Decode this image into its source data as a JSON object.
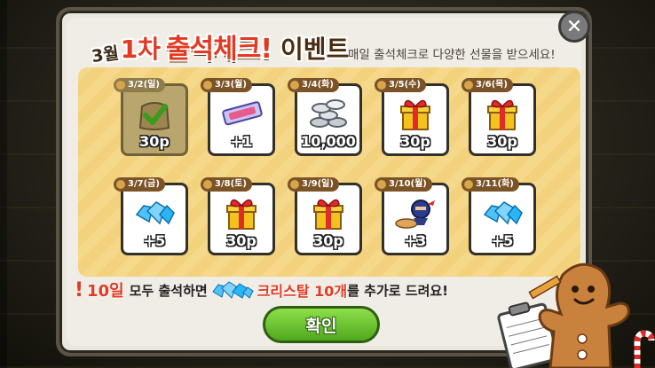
{
  "title": {
    "month": "3월",
    "round": "1차",
    "main": "출석체크!",
    "event": "이벤트",
    "subtitle": "매일 출석체크로 다양한 선물을 받으세요!"
  },
  "rewards": [
    {
      "date": "3/2(일)",
      "icon": "check-pouch-icon",
      "amount": "30p",
      "claimed": true
    },
    {
      "date": "3/3(월)",
      "icon": "ticket-icon",
      "amount": "+1",
      "claimed": false
    },
    {
      "date": "3/4(화)",
      "icon": "coins-icon",
      "amount": "10,000",
      "claimed": false
    },
    {
      "date": "3/5(수)",
      "icon": "gift-icon",
      "amount": "30p",
      "claimed": false
    },
    {
      "date": "3/6(목)",
      "icon": "gift-icon",
      "amount": "30p",
      "claimed": false
    },
    {
      "date": "3/7(금)",
      "icon": "crystal-icon",
      "amount": "+5",
      "claimed": false
    },
    {
      "date": "3/8(토)",
      "icon": "gift-icon",
      "amount": "30p",
      "claimed": false
    },
    {
      "date": "3/9(일)",
      "icon": "gift-icon",
      "amount": "30p",
      "claimed": false
    },
    {
      "date": "3/10(월)",
      "icon": "ninja-cookie-icon",
      "amount": "+3",
      "claimed": false
    },
    {
      "date": "3/11(화)",
      "icon": "crystal-icon",
      "amount": "+5",
      "claimed": false
    }
  ],
  "banner": {
    "days": "10일",
    "text1": "모두 출석하면",
    "crystal": "크리스탈 10개",
    "text2": "를 추가로 드려요!"
  },
  "buttons": {
    "confirm": "확인",
    "close": "✕"
  },
  "colors": {
    "accent_red": "#e23a22",
    "confirm_green": "#4fa81e",
    "board_yellow": "#f6d88a"
  }
}
